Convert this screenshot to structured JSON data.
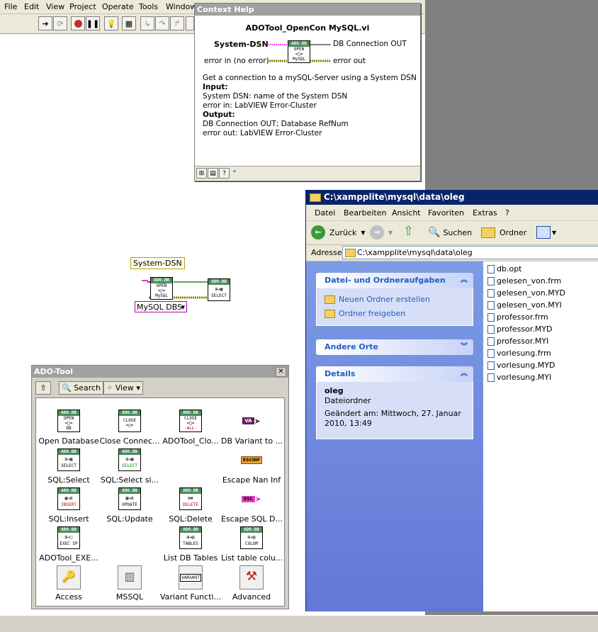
{
  "labview": {
    "menu": [
      "File",
      "Edit",
      "View",
      "Project",
      "Operate",
      "Tools",
      "Window"
    ],
    "diagram": {
      "dsn_constant": "System-DSN",
      "mysql_ring": "MySQL DBS",
      "open_icon_lines": [
        "ADO.DB",
        "OPEN",
        "MySQL"
      ],
      "select_icon_lines": [
        "ADO.DB",
        "SELECT"
      ]
    }
  },
  "context_help": {
    "title": "Context Help",
    "vi_name": "ADOTool_OpenCon MySQL.vi",
    "terminals": {
      "system_dsn": "System-DSN",
      "db_conn_out": "DB Connection OUT",
      "error_in": "error in (no error)",
      "error_out": "error out"
    },
    "description": "Get a connection to a mySQL-Server using a System DSN",
    "input_header": "Input:",
    "input_lines": [
      "System DSN: name of the System DSN",
      "error in: LabVIEW Error-Cluster"
    ],
    "output_header": "Output:",
    "output_lines": [
      "DB Connection OUT; Database RefNum",
      "error out: LabVIEW Error-Cluster"
    ]
  },
  "palette": {
    "title": "ADO-Tool",
    "search_label": "Search",
    "view_label": "View",
    "items": [
      {
        "label": "Open Database",
        "icon": [
          "ADO.DB",
          "OPEN",
          "DB"
        ]
      },
      {
        "label": "Close Connec...",
        "icon": [
          "ADO.DB",
          "CLOSE",
          ""
        ]
      },
      {
        "label": "ADOTool_Clo...",
        "icon": [
          "ADO.DB",
          "CLOSE",
          "-ALL-"
        ]
      },
      {
        "label": "DB Variant to ...",
        "icon": [
          "VA"
        ]
      },
      {
        "label": "SQL:Select",
        "icon": [
          "ADO.DB",
          "SELECT"
        ]
      },
      {
        "label": "SQL:Select si...",
        "icon": [
          "ADO.DB",
          "SELECT"
        ]
      },
      {
        "label": "",
        "icon": []
      },
      {
        "label": "Escape Nan Inf",
        "icon": [
          "ESCINF"
        ]
      },
      {
        "label": "SQL:Insert",
        "icon": [
          "ADO.DB",
          "INSERT"
        ]
      },
      {
        "label": "SQL:Update",
        "icon": [
          "ADO.DB",
          "UPDATE"
        ]
      },
      {
        "label": "SQL:Delete",
        "icon": [
          "ADO.DB",
          "DELETE"
        ]
      },
      {
        "label": "Escape SQL D...",
        "icon": [
          "ESC"
        ]
      },
      {
        "label": "ADOTool_EXE...",
        "icon": [
          "ADO.DB",
          "EXEC SP"
        ]
      },
      {
        "label": "",
        "icon": []
      },
      {
        "label": "List DB Tables",
        "icon": [
          "ADO.DB",
          "TABLES"
        ]
      },
      {
        "label": "List table colu...",
        "icon": [
          "ADO.DB",
          "COLUM"
        ]
      },
      {
        "label": "Access",
        "icon": [
          "access"
        ]
      },
      {
        "label": "MSSQL",
        "icon": [
          "mssql"
        ]
      },
      {
        "label": "Variant Functi...",
        "icon": [
          "VARIANT"
        ]
      },
      {
        "label": "Advanced",
        "icon": [
          "tools"
        ]
      }
    ]
  },
  "explorer": {
    "title": "C:\\xampplite\\mysql\\data\\oleg",
    "menu": [
      "Datei",
      "Bearbeiten",
      "Ansicht",
      "Favoriten",
      "Extras",
      "?"
    ],
    "back_label": "Zurück",
    "search_label": "Suchen",
    "folders_label": "Ordner",
    "address_label": "Adresse",
    "address_value": "C:\\xampplite\\mysql\\data\\oleg",
    "tasks_title": "Datei- und Ordneraufgaben",
    "tasks": [
      "Neuen Ordner erstellen",
      "Ordner freigeben"
    ],
    "other_title": "Andere Orte",
    "details_title": "Details",
    "details_name": "oleg",
    "details_type": "Dateiordner",
    "details_modified": "Geändert am: Mittwoch, 27. Januar",
    "details_modified2": "2010, 13:49",
    "files": [
      "db.opt",
      "gelesen_von.frm",
      "gelesen_von.MYD",
      "gelesen_von.MYI",
      "professor.frm",
      "professor.MYD",
      "professor.MYI",
      "vorlesung.frm",
      "vorlesung.MYD",
      "vorlesung.MYI"
    ]
  }
}
